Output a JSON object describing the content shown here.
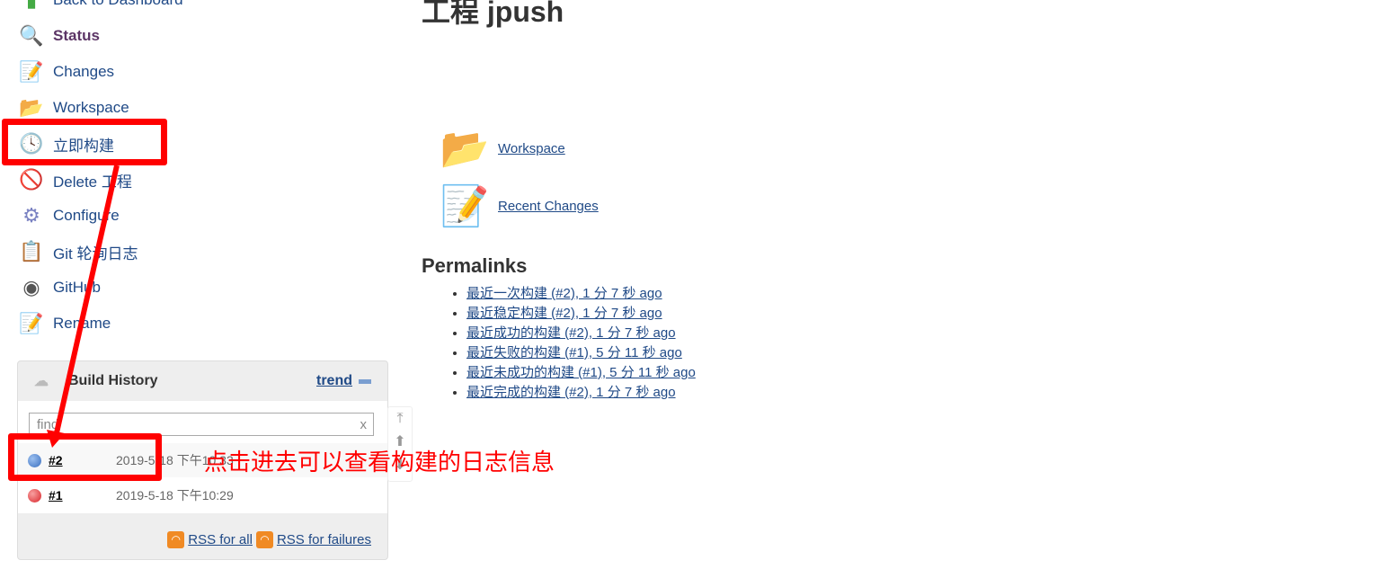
{
  "sidebar": {
    "items": [
      {
        "label": "Back to Dashboard",
        "icon": "up-arrow-icon"
      },
      {
        "label": "Status",
        "icon": "magnifier-icon"
      },
      {
        "label": "Changes",
        "icon": "notepad-icon"
      },
      {
        "label": "Workspace",
        "icon": "folder-icon"
      },
      {
        "label": "立即构建",
        "icon": "build-clock-icon"
      },
      {
        "label": "Delete 工程",
        "icon": "no-entry-icon"
      },
      {
        "label": "Configure",
        "icon": "gear-icon"
      },
      {
        "label": "Git 轮询日志",
        "icon": "clipboard-icon"
      },
      {
        "label": "GitHub",
        "icon": "github-icon"
      },
      {
        "label": "Rename",
        "icon": "notepad-icon"
      }
    ]
  },
  "main": {
    "title": "工程 jpush",
    "links": [
      {
        "label": "Workspace"
      },
      {
        "label": "Recent Changes"
      }
    ],
    "permalinks_title": "Permalinks",
    "permalinks": [
      "最近一次构建 (#2), 1 分 7 秒 ago",
      "最近稳定构建 (#2), 1 分 7 秒 ago",
      "最近成功的构建 (#2), 1 分 7 秒 ago",
      "最近失败的构建 (#1), 5 分 11 秒 ago",
      "最近未成功的构建 (#1), 5 分 11 秒 ago",
      "最近完成的构建 (#2), 1 分 7 秒 ago"
    ]
  },
  "build_history": {
    "title": "Build History",
    "trend": "trend",
    "find_placeholder": "find",
    "clear": "x",
    "builds": [
      {
        "id": "#2",
        "time": "2019-5-18 下午10:33",
        "color": "#3a6fbf"
      },
      {
        "id": "#1",
        "time": "2019-5-18 下午10:29",
        "color": "#d9252a"
      }
    ],
    "rss_all": "RSS for all",
    "rss_failures": "RSS for failures"
  },
  "annotation": {
    "text": "点击进去可以查看构建的日志信息",
    "color": "#ff0000"
  }
}
